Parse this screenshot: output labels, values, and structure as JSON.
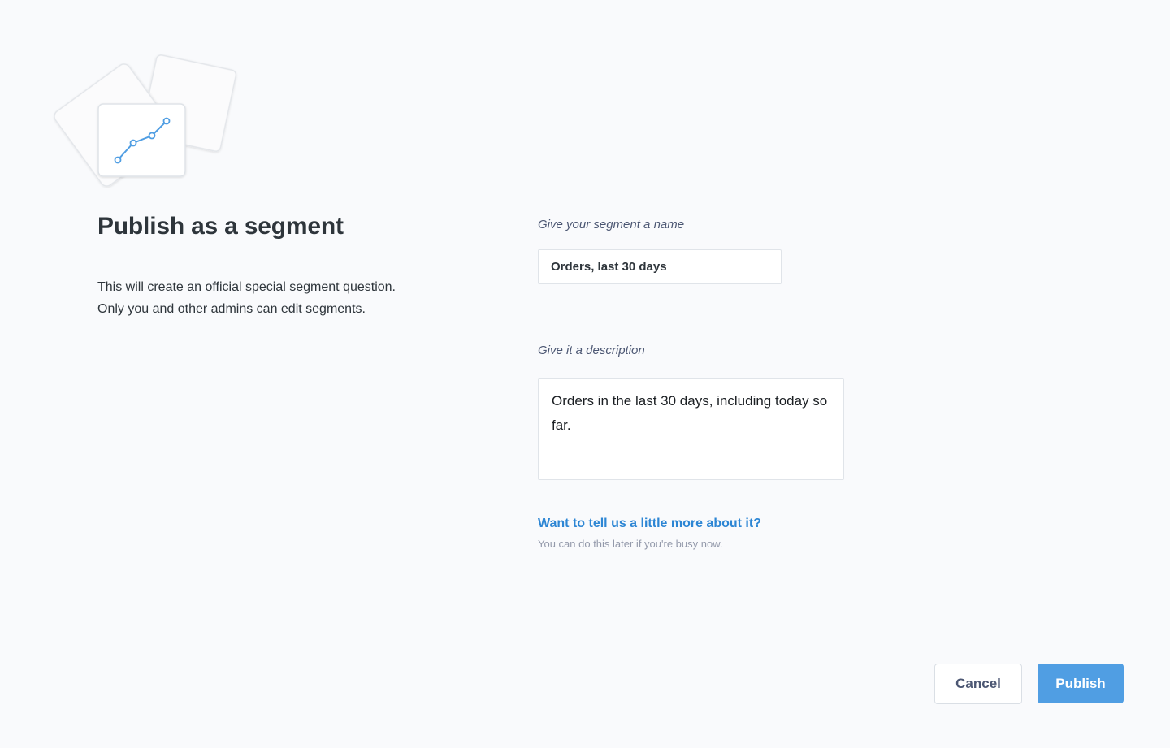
{
  "header": {
    "title": "Publish as a segment",
    "description_lines": [
      "This will create an official special segment question.",
      "Only you and other admins can edit segments."
    ]
  },
  "form": {
    "name_label": "Give your segment a name",
    "name_value": "Orders, last 30 days",
    "description_label": "Give it a description",
    "description_value": "Orders in the last 30 days, including today so far.",
    "more_link": "Want to tell us a little more about it?",
    "more_hint": "You can do this later if you're busy now."
  },
  "actions": {
    "cancel_label": "Cancel",
    "publish_label": "Publish"
  },
  "colors": {
    "accent": "#509ee3",
    "link": "#2d86d4",
    "background": "#f9fafc"
  },
  "icons": {
    "illustration": "segment-cards-chart-illustration"
  }
}
